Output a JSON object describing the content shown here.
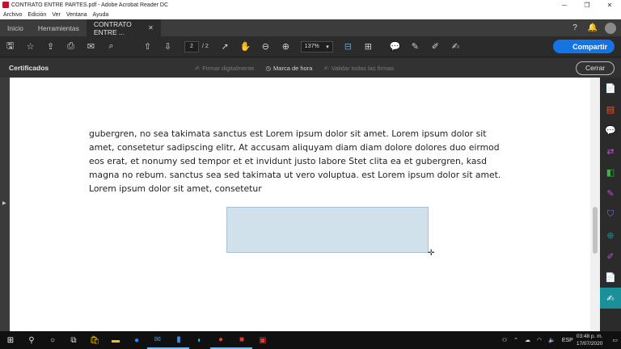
{
  "window": {
    "title": "CONTRATO ENTRE PARTES.pdf - Adobe Acrobat Reader DC",
    "minimize": "─",
    "maximize": "❐",
    "close": "✕"
  },
  "menu": [
    "Archivo",
    "Edición",
    "Ver",
    "Ventana",
    "Ayuda"
  ],
  "tabs": {
    "home": "Inicio",
    "tools": "Herramientas",
    "document": "CONTRATO ENTRE ...",
    "document_close": "✕"
  },
  "header_icons": {
    "help": "?",
    "notifications": "🔔"
  },
  "toolbar": {
    "current_page": "2",
    "total_pages": "/ 2",
    "zoom": "137%",
    "zoom_arrow": "▾",
    "share_label": "Compartir",
    "save_icon": "🖫",
    "bookmark_icon": "☆",
    "upload_icon": "⇪",
    "print_icon": "⎙",
    "mail_icon": "✉",
    "search_icon": "⌕",
    "page_up_icon": "⇧",
    "page_down_icon": "⇩",
    "select_icon": "➚",
    "hand_icon": "✋",
    "zoom_out_icon": "⊖",
    "zoom_in_icon": "⊕",
    "fit_icon": "⊟",
    "scroll_icon": "⊞",
    "comment_icon": "💬",
    "highlight_icon": "✎",
    "draw_icon": "✐",
    "sign_icon": "✍"
  },
  "certificates": {
    "title": "Certificados",
    "sign_digitally": "Firmar digitalmente",
    "timestamp": "Marca de hora",
    "validate_all": "Validar todas las firmas",
    "close": "Cerrar"
  },
  "document": {
    "paragraph": "gubergren, no sea takimata sanctus est Lorem ipsum dolor sit amet. Lorem ipsum dolor sit amet, consetetur sadipscing elitr, At accusam aliquyam diam diam dolore dolores duo eirmod eos erat, et nonumy sed tempor et et invidunt justo labore Stet clita ea et gubergren, kasd magna no rebum. sanctus sea sed takimata ut vero voluptua. est Lorem ipsum dolor sit amet. Lorem ipsum dolor sit amet, consetetur"
  },
  "right_panel_icons": [
    {
      "name": "create-pdf-icon",
      "glyph": "📄",
      "color": "#e8542e"
    },
    {
      "name": "organize-pages-icon",
      "glyph": "▤",
      "color": "#e8542e"
    },
    {
      "name": "comment-icon",
      "glyph": "💬",
      "color": "#f5c400"
    },
    {
      "name": "export-pdf-icon",
      "glyph": "⇄",
      "color": "#c64bd8"
    },
    {
      "name": "export-icon",
      "glyph": "◧",
      "color": "#40b14a"
    },
    {
      "name": "fill-sign-icon",
      "glyph": "✎",
      "color": "#c64bd8"
    },
    {
      "name": "protect-icon",
      "glyph": "⛉",
      "color": "#7b6fe6"
    },
    {
      "name": "compress-icon",
      "glyph": "⊕",
      "color": "#1b8f9a"
    },
    {
      "name": "edit-pdf-icon",
      "glyph": "✐",
      "color": "#c64bd8"
    },
    {
      "name": "send-icon",
      "glyph": "📄",
      "color": "#f5c400"
    },
    {
      "name": "certificates-icon",
      "glyph": "✍",
      "color": "#ffffff",
      "active": true
    }
  ],
  "taskbar": {
    "tray_lang": "ESP",
    "time": "03:48 p. m.",
    "date": "17/07/2020"
  }
}
